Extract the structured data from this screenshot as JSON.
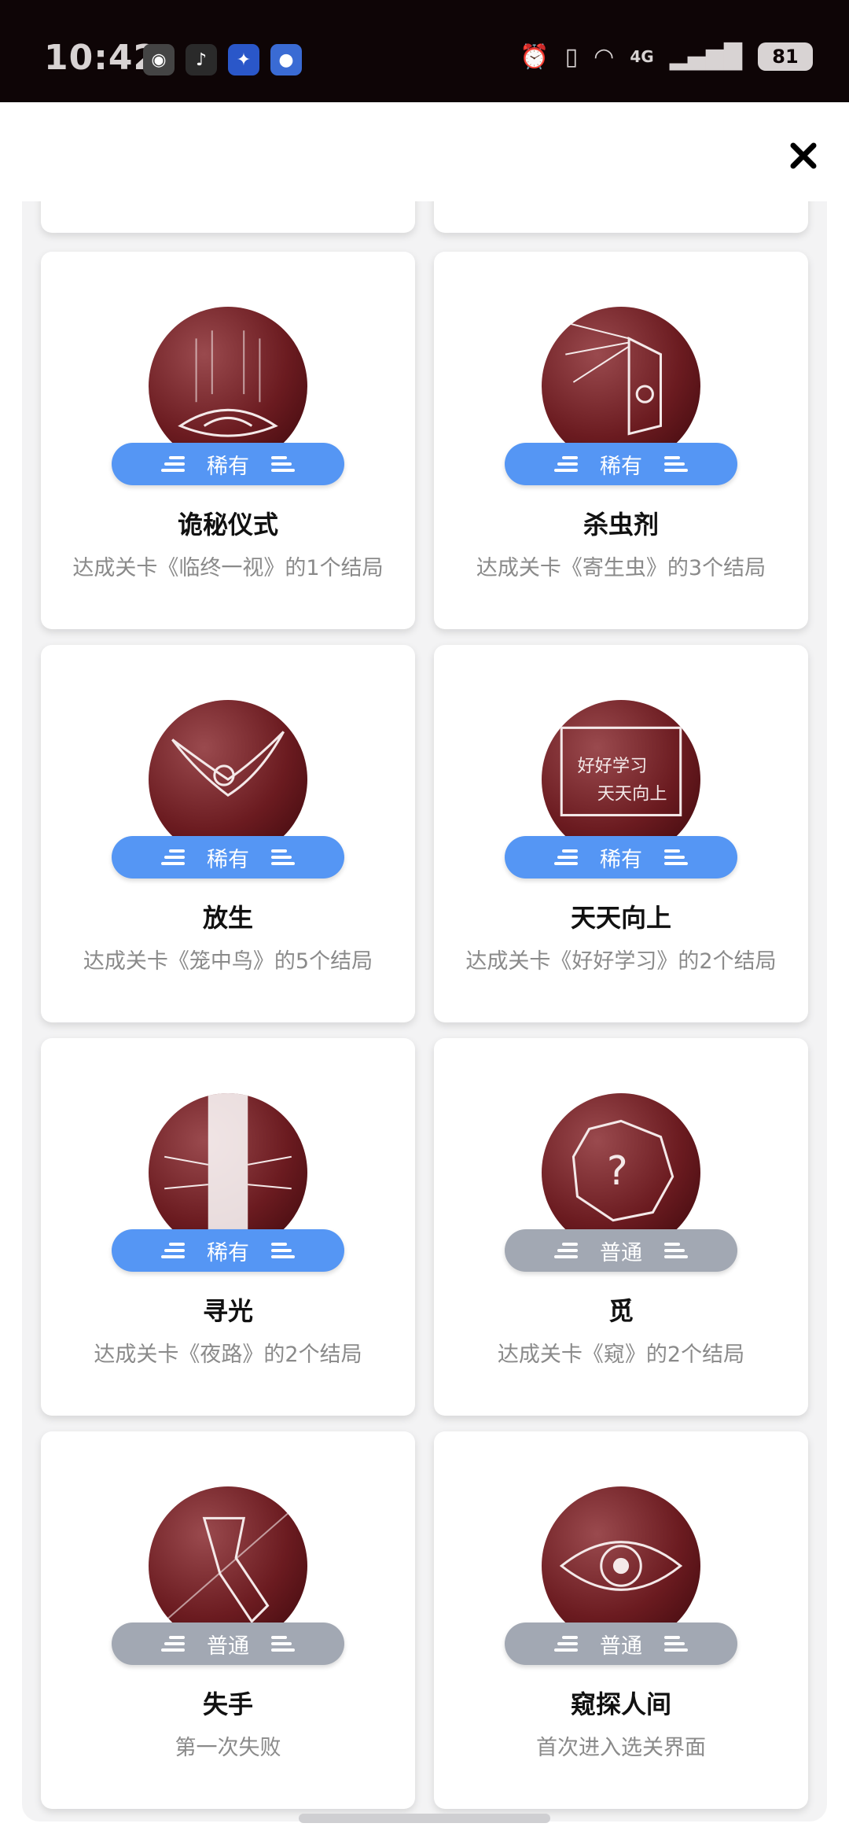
{
  "status_bar": {
    "time": "10:42",
    "battery": "81",
    "network": "4G"
  },
  "achievements": [
    {
      "title": "诡秘仪式",
      "rarity": "稀有",
      "description": "达成关卡《临终一视》的1个结局"
    },
    {
      "title": "杀虫剂",
      "rarity": "稀有",
      "description": "达成关卡《寄生虫》的3个结局"
    },
    {
      "title": "放生",
      "rarity": "稀有",
      "description": "达成关卡《笼中鸟》的5个结局"
    },
    {
      "title": "天天向上",
      "rarity": "稀有",
      "description": "达成关卡《好好学习》的2个结局",
      "illustration_text": [
        "好好学习",
        "天天向上"
      ]
    },
    {
      "title": "寻光",
      "rarity": "稀有",
      "description": "达成关卡《夜路》的2个结局"
    },
    {
      "title": "觅",
      "rarity": "普通",
      "description": "达成关卡《窥》的2个结局"
    },
    {
      "title": "失手",
      "rarity": "普通",
      "description": "第一次失败"
    },
    {
      "title": "窥探人间",
      "rarity": "普通",
      "description": "首次进入选关界面"
    }
  ],
  "colors": {
    "rare": "#5596f4",
    "common": "#a2a8b3",
    "medal": "#6b1b20"
  },
  "icons": {
    "close": "close-icon"
  }
}
